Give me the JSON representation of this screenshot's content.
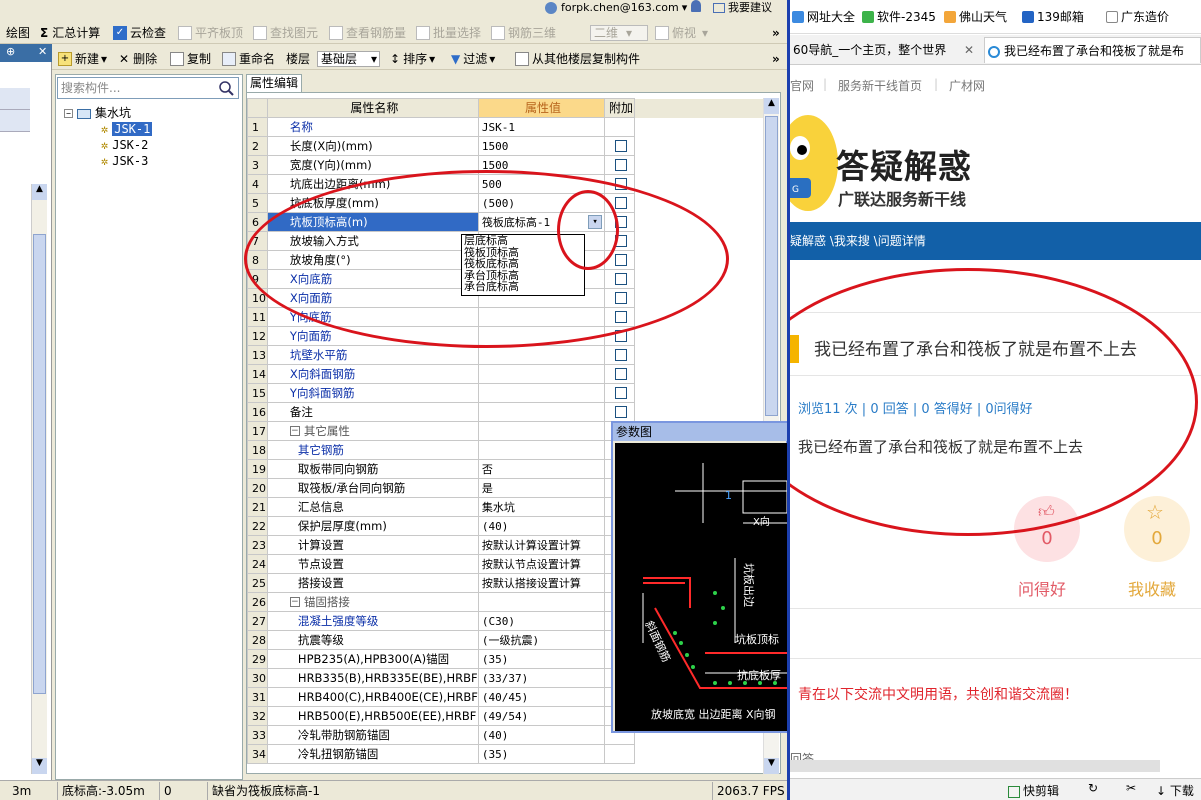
{
  "app": {
    "top_toolbar": {
      "items": [
        {
          "label": "绘图",
          "disabled": false
        },
        {
          "label": "汇总计算",
          "disabled": false
        },
        {
          "label": "云检查",
          "disabled": false
        },
        {
          "label": "平齐板顶",
          "disabled": true
        },
        {
          "label": "查找图元",
          "disabled": true
        },
        {
          "label": "查看钢筋量",
          "disabled": true
        },
        {
          "label": "批量选择",
          "disabled": true
        },
        {
          "label": "钢筋三维",
          "disabled": true
        },
        {
          "label": "二维",
          "disabled": true
        },
        {
          "label": "俯视",
          "disabled": true
        }
      ],
      "account": "forpk.chen@163.com",
      "ask": "我要建议"
    },
    "second_toolbar": {
      "new": "新建",
      "delete": "删除",
      "copy": "复制",
      "rename": "重命名",
      "floor_label": "楼层",
      "floor_value": "基础层",
      "sort": "排序",
      "filter": "过滤",
      "copy_from_floor": "从其他楼层复制构件"
    },
    "tree": {
      "search_placeholder": "搜索构件...",
      "root": "集水坑",
      "children": [
        "JSK-1",
        "JSK-2",
        "JSK-3"
      ],
      "selected": "JSK-1"
    },
    "property_panel": {
      "tab": "属性编辑",
      "headers": {
        "name": "属性名称",
        "value": "属性值",
        "extra": "附加"
      },
      "rows": [
        {
          "n": "1",
          "name": "名称",
          "value": "JSK-1",
          "blue": true,
          "cb": false,
          "indent": 0
        },
        {
          "n": "2",
          "name": "长度(X向)(mm)",
          "value": "1500",
          "blue": false,
          "cb": true,
          "indent": 0
        },
        {
          "n": "3",
          "name": "宽度(Y向)(mm)",
          "value": "1500",
          "blue": false,
          "cb": true,
          "indent": 0
        },
        {
          "n": "4",
          "name": "坑底出边距离(mm)",
          "value": "500",
          "blue": false,
          "cb": true,
          "indent": 0
        },
        {
          "n": "5",
          "name": "坑底板厚度(mm)",
          "value": "(500)",
          "blue": false,
          "cb": true,
          "indent": 0
        },
        {
          "n": "6",
          "name": "坑板顶标高(m)",
          "value": "筏板底标高-1",
          "blue": false,
          "cb": true,
          "indent": 0,
          "selected": true
        },
        {
          "n": "7",
          "name": "放坡输入方式",
          "value": "",
          "blue": false,
          "cb": true,
          "indent": 0
        },
        {
          "n": "8",
          "name": "放坡角度(°)",
          "value": "",
          "blue": false,
          "cb": true,
          "indent": 0
        },
        {
          "n": "9",
          "name": "X向底筋",
          "value": "",
          "blue": true,
          "cb": true,
          "indent": 0
        },
        {
          "n": "10",
          "name": "X向面筋",
          "value": "",
          "blue": true,
          "cb": true,
          "indent": 0
        },
        {
          "n": "11",
          "name": "Y向底筋",
          "value": "",
          "blue": true,
          "cb": true,
          "indent": 0
        },
        {
          "n": "12",
          "name": "Y向面筋",
          "value": "",
          "blue": true,
          "cb": true,
          "indent": 0
        },
        {
          "n": "13",
          "name": "坑壁水平筋",
          "value": "",
          "blue": true,
          "cb": true,
          "indent": 0
        },
        {
          "n": "14",
          "name": "X向斜面钢筋",
          "value": "",
          "blue": true,
          "cb": true,
          "indent": 0
        },
        {
          "n": "15",
          "name": "Y向斜面钢筋",
          "value": "",
          "blue": true,
          "cb": true,
          "indent": 0
        },
        {
          "n": "16",
          "name": "备注",
          "value": "",
          "blue": false,
          "cb": true,
          "indent": 0
        },
        {
          "n": "17",
          "name": "其它属性",
          "value": "",
          "blue": false,
          "cb": false,
          "indent": 0,
          "group": true
        },
        {
          "n": "18",
          "name": "其它钢筋",
          "value": "",
          "blue": true,
          "cb": false,
          "indent": 1
        },
        {
          "n": "19",
          "name": "取板带同向钢筋",
          "value": "否",
          "blue": false,
          "cb": true,
          "indent": 1
        },
        {
          "n": "20",
          "name": "取筏板/承台同向钢筋",
          "value": "是",
          "blue": false,
          "cb": true,
          "indent": 1
        },
        {
          "n": "21",
          "name": "汇总信息",
          "value": "集水坑",
          "blue": false,
          "cb": true,
          "indent": 1
        },
        {
          "n": "22",
          "name": "保护层厚度(mm)",
          "value": "(40)",
          "blue": false,
          "cb": true,
          "indent": 1
        },
        {
          "n": "23",
          "name": "计算设置",
          "value": "按默认计算设置计算",
          "blue": false,
          "cb": false,
          "indent": 1
        },
        {
          "n": "24",
          "name": "节点设置",
          "value": "按默认节点设置计算",
          "blue": false,
          "cb": false,
          "indent": 1
        },
        {
          "n": "25",
          "name": "搭接设置",
          "value": "按默认搭接设置计算",
          "blue": false,
          "cb": false,
          "indent": 1
        },
        {
          "n": "26",
          "name": "锚固搭接",
          "value": "",
          "blue": false,
          "cb": false,
          "indent": 0,
          "group": true
        },
        {
          "n": "27",
          "name": "混凝土强度等级",
          "value": "(C30)",
          "blue": true,
          "cb": true,
          "indent": 1
        },
        {
          "n": "28",
          "name": "抗震等级",
          "value": "(一级抗震)",
          "blue": false,
          "cb": true,
          "indent": 1
        },
        {
          "n": "29",
          "name": "HPB235(A),HPB300(A)锚固",
          "value": "(35)",
          "blue": false,
          "cb": false,
          "indent": 1
        },
        {
          "n": "30",
          "name": "HRB335(B),HRB335E(BE),HRBF",
          "value": "(33/37)",
          "blue": false,
          "cb": false,
          "indent": 1
        },
        {
          "n": "31",
          "name": "HRB400(C),HRB400E(CE),HRBF",
          "value": "(40/45)",
          "blue": false,
          "cb": false,
          "indent": 1
        },
        {
          "n": "32",
          "name": "HRB500(E),HRB500E(EE),HRBF",
          "value": "(49/54)",
          "blue": false,
          "cb": false,
          "indent": 1
        },
        {
          "n": "33",
          "name": "冷轧带肋钢筋锚固",
          "value": "(40)",
          "blue": false,
          "cb": false,
          "indent": 1
        },
        {
          "n": "34",
          "name": "冷轧扭钢筋锚固",
          "value": "(35)",
          "blue": false,
          "cb": false,
          "indent": 1
        }
      ],
      "dropdown_options": [
        "层底标高",
        "筏板顶标高",
        "筏板底标高",
        "承台顶标高",
        "承台底标高"
      ]
    },
    "param_figure": {
      "title": "参数图",
      "labels": {
        "one": "1",
        "x_dir": "X向",
        "pit_edge": "坑板出边",
        "pit_top_elev": "坑板顶标",
        "pit_bottom": "抗底板厚",
        "slope_rebar": "斜面钢筋",
        "bottom_row": "放坡底宽 出边距离 X向钢"
      }
    },
    "status": {
      "coord": "3m",
      "elev": "底标高:-3.05m",
      "zero": "0",
      "message": "缺省为筏板底标高-1",
      "fps": "2063.7 FPS"
    }
  },
  "browser": {
    "bookmarks": [
      "网址大全",
      "软件-2345",
      "佛山天气",
      "139邮箱",
      "广东造价"
    ],
    "tabs": [
      {
        "label": "60导航_一个主页，整个世界",
        "active": false
      },
      {
        "label": "我已经布置了承台和筏板了就是布",
        "active": true
      }
    ],
    "site_nav": [
      "官网",
      "服务新干线首页",
      "广材网"
    ],
    "logo_text": "答疑解惑",
    "logo_sub": "广联达服务新干线",
    "breadcrumb": "疑解惑 \\我来搜 \\问题详情",
    "question_title": "我已经布置了承台和筏板了就是布置不上去",
    "stats": "浏览11 次 | 0 回答 | 0 答得好 | 0问得好",
    "question_body": "我已经布置了承台和筏板了就是布置不上去",
    "good_count": "0",
    "good_label": "问得好",
    "fav_count": "0",
    "fav_label": "我收藏",
    "rule_text": "青在以下交流中文明用语，共创和谐交流圈！",
    "answers_partial": "回答",
    "footer_items": [
      "快剪辑",
      "下载"
    ]
  }
}
